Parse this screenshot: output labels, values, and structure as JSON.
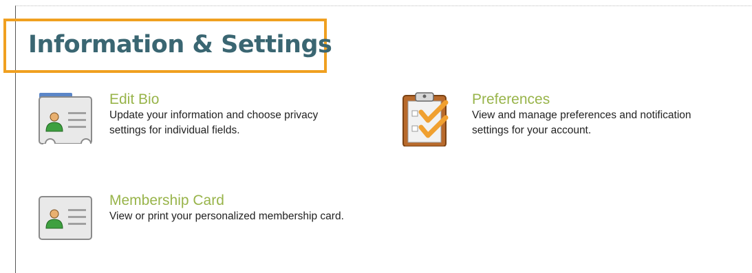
{
  "page": {
    "title": "Information & Settings"
  },
  "colors": {
    "title": "#3a6672",
    "highlight_box": "#f0a020",
    "link": "#98b44a",
    "text": "#222222"
  },
  "items": [
    {
      "label": "Edit Bio",
      "description": "Update your information and choose privacy settings for individual fields.",
      "icon": "id-card-icon"
    },
    {
      "label": "Preferences",
      "description": "View and manage preferences and notification settings for your account.",
      "icon": "clipboard-checklist-icon"
    },
    {
      "label": "Membership Card",
      "description": "View or print your personalized membership card.",
      "icon": "membership-card-icon"
    }
  ]
}
